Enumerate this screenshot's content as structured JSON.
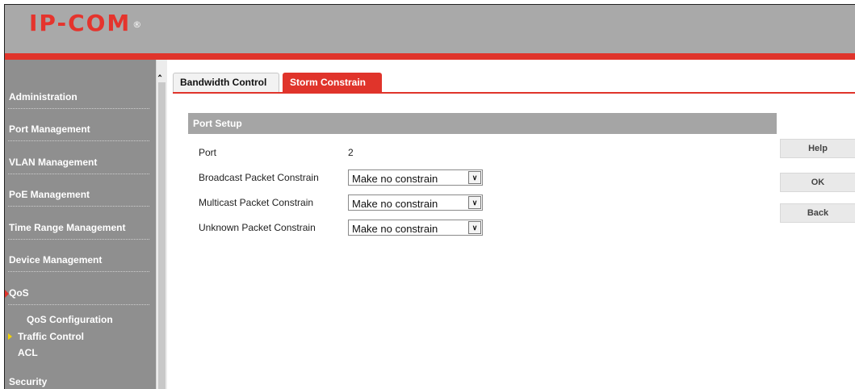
{
  "brand": {
    "logo_text": "IP-COM",
    "registered_mark": "®"
  },
  "colors": {
    "accent": "#e0342b",
    "sidebar_bg": "#8f8f8f",
    "header_bg": "#a9a9a9",
    "section_bg": "#a5a5a5"
  },
  "sidebar": {
    "items": [
      {
        "label": "Administration"
      },
      {
        "label": "Port Management"
      },
      {
        "label": "VLAN Management"
      },
      {
        "label": "PoE Management"
      },
      {
        "label": "Time Range Management"
      },
      {
        "label": "Device Management"
      },
      {
        "label": "QoS"
      },
      {
        "label": "Security"
      }
    ],
    "qos_subitems": [
      {
        "label": "QoS Configuration"
      },
      {
        "label": "Traffic Control"
      },
      {
        "label": "ACL"
      }
    ],
    "scroll_up_icon": "chevron-up"
  },
  "tabs": [
    {
      "label": "Bandwidth Control",
      "active": false
    },
    {
      "label": "Storm Constrain",
      "active": true
    }
  ],
  "section": {
    "title": "Port Setup",
    "port_label": "Port",
    "port_value": "2",
    "broadcast_label": "Broadcast Packet Constrain",
    "broadcast_value": "Make no constrain",
    "multicast_label": "Multicast Packet Constrain",
    "multicast_value": "Make no constrain",
    "unknown_label": "Unknown Packet Constrain",
    "unknown_value": "Make no constrain"
  },
  "buttons": {
    "help": "Help",
    "ok": "OK",
    "back": "Back"
  }
}
